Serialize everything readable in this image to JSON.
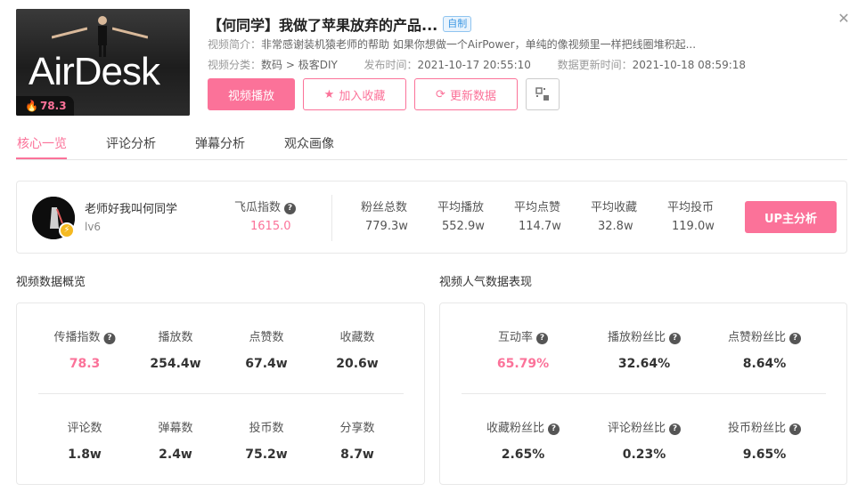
{
  "video": {
    "thumbnail_text": "AirDesk",
    "heat_score": "78.3",
    "title": "【何同学】我做了苹果放弃的产品...",
    "tag": "自制",
    "intro_label": "视频简介：",
    "intro_text": "非常感谢装机猿老师的帮助 如果你想做一个AirPower，单纯的像视频里一样把线圈堆积起...",
    "category_label": "视频分类：",
    "category_value": "数码 > 极客DIY",
    "publish_label": "发布时间：",
    "publish_value": "2021-10-17 20:55:10",
    "update_label": "数据更新时间：",
    "update_value": "2021-10-18 08:59:18"
  },
  "buttons": {
    "play": "视频播放",
    "favorite": "加入收藏",
    "refresh": "更新数据"
  },
  "tabs": [
    {
      "label": "核心一览",
      "active": true
    },
    {
      "label": "评论分析",
      "active": false
    },
    {
      "label": "弹幕分析",
      "active": false
    },
    {
      "label": "观众画像",
      "active": false
    }
  ],
  "up": {
    "name": "老师好我叫何同学",
    "level": "lv6",
    "feigua_label": "飞瓜指数",
    "feigua_value": "1615.0",
    "stats": [
      {
        "label": "粉丝总数",
        "value": "779.3w"
      },
      {
        "label": "平均播放",
        "value": "552.9w"
      },
      {
        "label": "平均点赞",
        "value": "114.7w"
      },
      {
        "label": "平均收藏",
        "value": "32.8w"
      },
      {
        "label": "平均投币",
        "value": "119.0w"
      }
    ],
    "analyze_button": "UP主分析"
  },
  "overview": {
    "title": "视频数据概览",
    "row1": [
      {
        "label": "传播指数",
        "value": "78.3",
        "help": true,
        "highlight": true
      },
      {
        "label": "播放数",
        "value": "254.4w"
      },
      {
        "label": "点赞数",
        "value": "67.4w"
      },
      {
        "label": "收藏数",
        "value": "20.6w"
      }
    ],
    "row2": [
      {
        "label": "评论数",
        "value": "1.8w"
      },
      {
        "label": "弹幕数",
        "value": "2.4w"
      },
      {
        "label": "投币数",
        "value": "75.2w"
      },
      {
        "label": "分享数",
        "value": "8.7w"
      }
    ]
  },
  "popularity": {
    "title": "视频人气数据表现",
    "row1": [
      {
        "label": "互动率",
        "value": "65.79%",
        "help": true,
        "highlight": true
      },
      {
        "label": "播放粉丝比",
        "value": "32.64%",
        "help": true
      },
      {
        "label": "点赞粉丝比",
        "value": "8.64%",
        "help": true
      }
    ],
    "row2": [
      {
        "label": "收藏粉丝比",
        "value": "2.65%",
        "help": true
      },
      {
        "label": "评论粉丝比",
        "value": "0.23%",
        "help": true
      },
      {
        "label": "投币粉丝比",
        "value": "9.65%",
        "help": true
      }
    ]
  },
  "colors": {
    "accent": "#fb7299",
    "tag_blue": "#3c97e3"
  }
}
